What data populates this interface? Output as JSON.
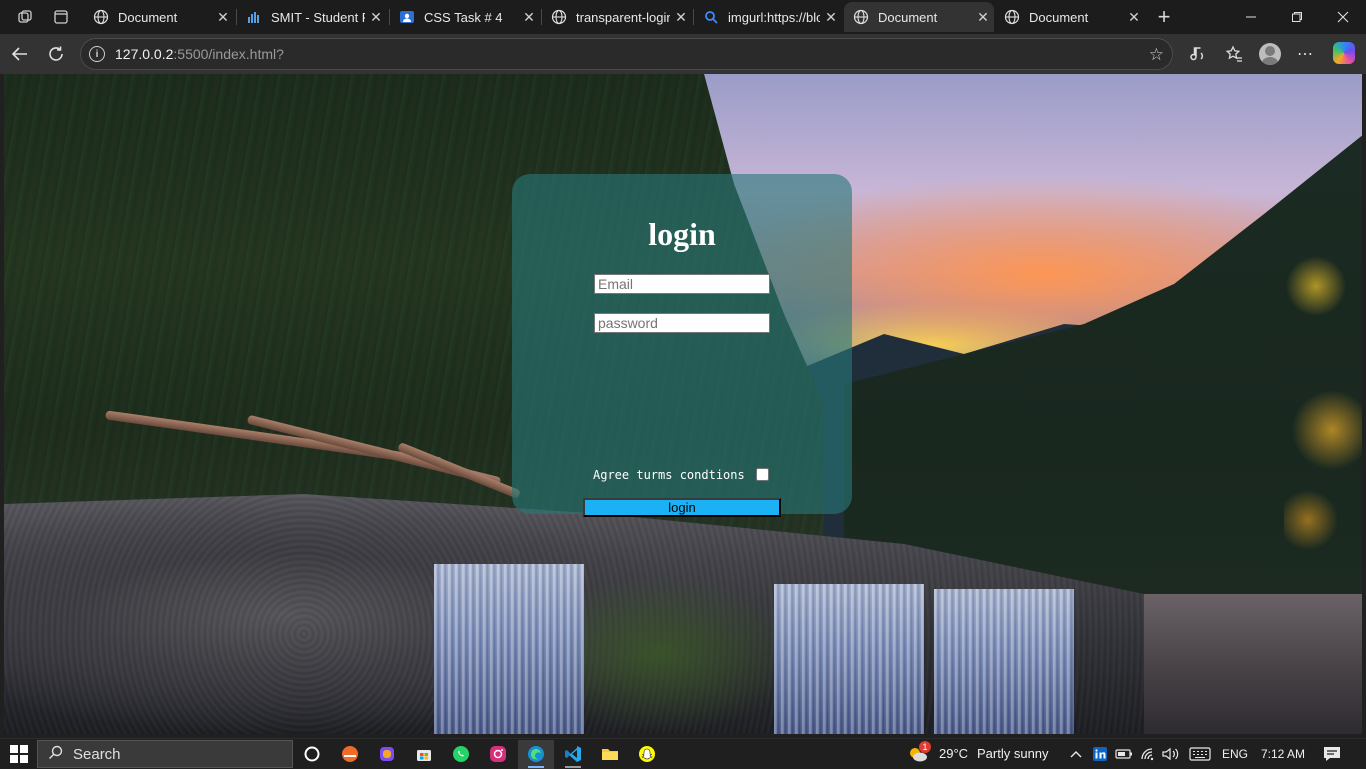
{
  "browser": {
    "tabs": [
      {
        "title": "Document",
        "active": false
      },
      {
        "title": "SMIT - Student Pc",
        "active": false
      },
      {
        "title": "CSS Task # 4",
        "active": false
      },
      {
        "title": "transparent-login",
        "active": false
      },
      {
        "title": "imgurl:https://blo",
        "active": false
      },
      {
        "title": "Document",
        "active": true
      },
      {
        "title": "Document",
        "active": false
      }
    ],
    "url_host": "127.0.0.2",
    "url_path": ":5500/index.html?"
  },
  "login": {
    "heading": "login",
    "email_placeholder": "Email",
    "password_placeholder": "password",
    "agree_label": "Agree turms condtions",
    "agree_checked": false,
    "button_label": "login"
  },
  "taskbar": {
    "search_label": "Search",
    "weather_badge": "1",
    "temperature": "29°C",
    "weather": "Partly sunny",
    "language": "ENG",
    "time": "7:12 AM"
  },
  "colors": {
    "card": "#28787899",
    "button": "#1ab2f5",
    "chrome_bg": "#1c1c1c",
    "active_tab": "#333333"
  }
}
